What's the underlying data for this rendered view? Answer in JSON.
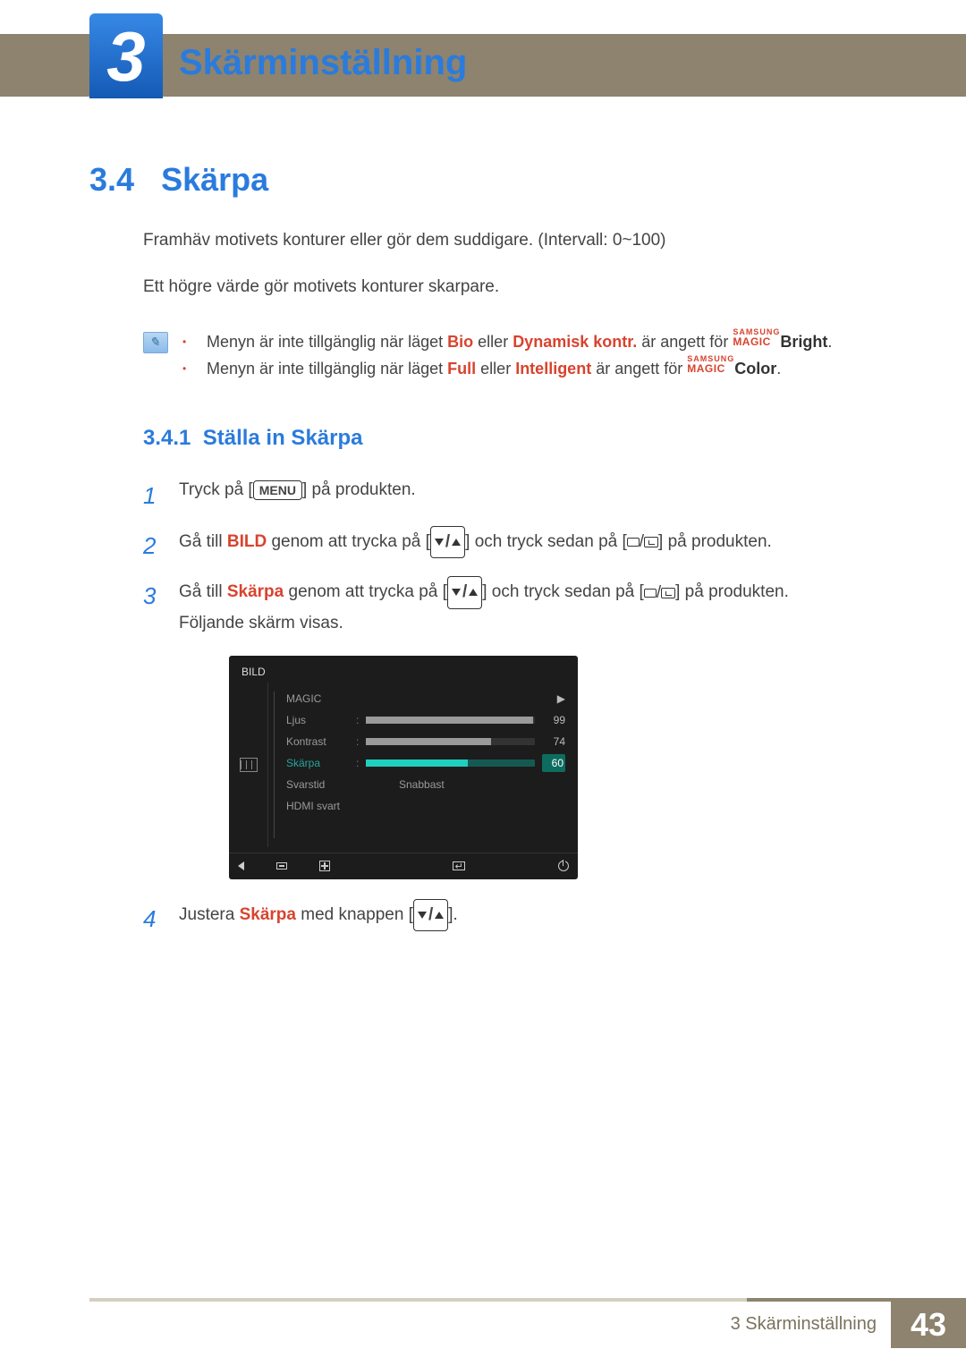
{
  "chapter_number": "3",
  "chapter_title": "Skärminställning",
  "section": {
    "number": "3.4",
    "title": "Skärpa",
    "intro_1": "Framhäv motivets konturer eller gör dem suddigare. (Intervall: 0~100)",
    "intro_2": "Ett högre värde gör motivets konturer skarpare."
  },
  "notes": {
    "line1_pre": "Menyn är inte tillgänglig när läget ",
    "line1_hl1": "Bio",
    "line1_mid": " eller ",
    "line1_hl2": "Dynamisk kontr.",
    "line1_post": " är angett för ",
    "line1_brand": "Bright",
    "line2_pre": "Menyn är inte tillgänglig när läget ",
    "line2_hl1": "Full",
    "line2_mid": " eller ",
    "line2_hl2": "Intelligent",
    "line2_post": " är angett för ",
    "line2_brand": "Color",
    "samsung": "SAMSUNG",
    "magic": "MAGIC"
  },
  "sub": {
    "number": "3.4.1",
    "title": "Ställa in Skärpa"
  },
  "steps": {
    "n1": "1",
    "n2": "2",
    "n3": "3",
    "n4": "4",
    "s1a": "Tryck på [",
    "s1b": "MENU",
    "s1c": "] på produkten.",
    "s2a": "Gå till ",
    "s2b": "BILD",
    "s2c": " genom att trycka på [",
    "s2d": "] och tryck sedan på [",
    "s2e": "] på produkten.",
    "s3a": "Gå till ",
    "s3b": "Skärpa",
    "s3c": " genom att trycka på [",
    "s3d": "] och tryck sedan på [",
    "s3e": "] på produkten.",
    "s3f": "Följande skärm visas.",
    "s4a": "Justera ",
    "s4b": "Skärpa",
    "s4c": " med knappen [",
    "s4d": "]."
  },
  "osd": {
    "title": "BILD",
    "rows": [
      {
        "label": "MAGIC",
        "type": "arrow"
      },
      {
        "label": "Ljus",
        "type": "bar",
        "value": 99,
        "fill": 99
      },
      {
        "label": "Kontrast",
        "type": "bar",
        "value": 74,
        "fill": 74
      },
      {
        "label": "Skärpa",
        "type": "bar",
        "value": 60,
        "fill": 60,
        "selected": true
      },
      {
        "label": "Svarstid",
        "type": "text",
        "text": "Snabbast"
      },
      {
        "label": "HDMI svart",
        "type": "none"
      }
    ]
  },
  "footer": {
    "chapter_ref": "3 Skärminställning",
    "page": "43"
  }
}
